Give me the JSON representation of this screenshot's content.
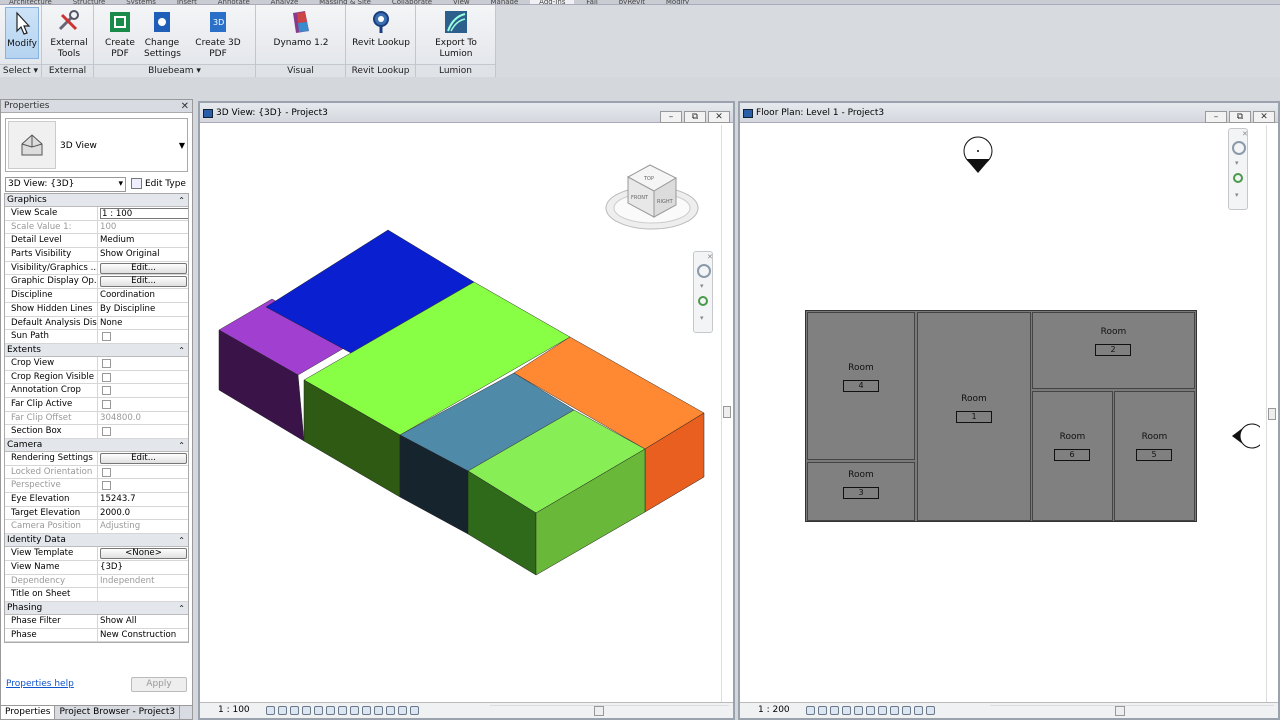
{
  "ribbon": {
    "tabs": [
      "Architecture",
      "Structure",
      "Systems",
      "Insert",
      "Annotate",
      "Analyze",
      "Massing & Site",
      "Collaborate",
      "View",
      "Manage",
      "Add-Ins",
      "Fall",
      "pyRevit",
      "Modify"
    ],
    "modify_label": "Modify",
    "select_label": "Select",
    "external_tools_label": "External\nTools",
    "external_panel": "External",
    "create_pdf_label": "Create PDF",
    "change_settings_label": "Change\nSettings",
    "create_3d_pdf_label": "Create 3D PDF",
    "bluebeam_panel": "Bluebeam",
    "dynamo_label": "Dynamo 1.2",
    "visual_programming_panel": "Visual Programming",
    "revit_lookup_label": "Revit Lookup",
    "revit_lookup_panel": "Revit Lookup",
    "export_lumion_label": "Export To Lumion",
    "lumion_panel": "Lumion"
  },
  "properties": {
    "title": "Properties",
    "type_name": "3D View",
    "instance_selector": "3D View: {3D}",
    "edit_type": "Edit Type",
    "groups": [
      {
        "name": "Graphics",
        "rows": [
          {
            "k": "View Scale",
            "v": "1 : 100",
            "kind": "input"
          },
          {
            "k": "Scale Value    1:",
            "v": "100",
            "dim": true
          },
          {
            "k": "Detail Level",
            "v": "Medium"
          },
          {
            "k": "Parts Visibility",
            "v": "Show Original"
          },
          {
            "k": "Visibility/Graphics ...",
            "v": "Edit...",
            "kind": "button"
          },
          {
            "k": "Graphic Display Op...",
            "v": "Edit...",
            "kind": "button"
          },
          {
            "k": "Discipline",
            "v": "Coordination"
          },
          {
            "k": "Show Hidden Lines",
            "v": "By Discipline"
          },
          {
            "k": "Default Analysis Dis...",
            "v": "None"
          },
          {
            "k": "Sun Path",
            "v": "",
            "kind": "check"
          }
        ]
      },
      {
        "name": "Extents",
        "rows": [
          {
            "k": "Crop View",
            "v": "",
            "kind": "check"
          },
          {
            "k": "Crop Region Visible",
            "v": "",
            "kind": "check"
          },
          {
            "k": "Annotation Crop",
            "v": "",
            "kind": "check"
          },
          {
            "k": "Far Clip Active",
            "v": "",
            "kind": "check"
          },
          {
            "k": "Far Clip Offset",
            "v": "304800.0",
            "dim": true
          },
          {
            "k": "Section Box",
            "v": "",
            "kind": "check"
          }
        ]
      },
      {
        "name": "Camera",
        "rows": [
          {
            "k": "Rendering Settings",
            "v": "Edit...",
            "kind": "button"
          },
          {
            "k": "Locked Orientation",
            "v": "",
            "kind": "check",
            "dim": true
          },
          {
            "k": "Perspective",
            "v": "",
            "kind": "check",
            "dim": true
          },
          {
            "k": "Eye Elevation",
            "v": "15243.7"
          },
          {
            "k": "Target Elevation",
            "v": "2000.0"
          },
          {
            "k": "Camera Position",
            "v": "Adjusting",
            "dim": true
          }
        ]
      },
      {
        "name": "Identity Data",
        "rows": [
          {
            "k": "View Template",
            "v": "<None>",
            "kind": "button"
          },
          {
            "k": "View Name",
            "v": "{3D}"
          },
          {
            "k": "Dependency",
            "v": "Independent",
            "dim": true
          },
          {
            "k": "Title on Sheet",
            "v": ""
          }
        ]
      },
      {
        "name": "Phasing",
        "rows": [
          {
            "k": "Phase Filter",
            "v": "Show All"
          },
          {
            "k": "Phase",
            "v": "New Construction"
          }
        ]
      }
    ],
    "help_link": "Properties help",
    "apply": "Apply",
    "tab_properties": "Properties",
    "tab_browser": "Project Browser - Project3"
  },
  "view3d": {
    "title": "3D View: {3D} - Project3",
    "scale": "1 : 100",
    "cube_top": "TOP",
    "cube_front": "FRONT",
    "cube_right": "RIGHT"
  },
  "floorplan": {
    "title": "Floor Plan: Level 1 - Project3",
    "scale": "1 : 200",
    "rooms": [
      {
        "name": "Room",
        "number": "4"
      },
      {
        "name": "Room",
        "number": "3"
      },
      {
        "name": "Room",
        "number": "1"
      },
      {
        "name": "Room",
        "number": "2"
      },
      {
        "name": "Room",
        "number": "6"
      },
      {
        "name": "Room",
        "number": "5"
      }
    ]
  },
  "colors": {
    "blue_block": "#0a1fd0",
    "purple_block": "#a13fd0",
    "green_block": "#88ff44",
    "orange_block": "#ff8833",
    "teal_block": "#4f8aa8",
    "lime_block": "#88ee55",
    "room_fill": "#808080"
  }
}
